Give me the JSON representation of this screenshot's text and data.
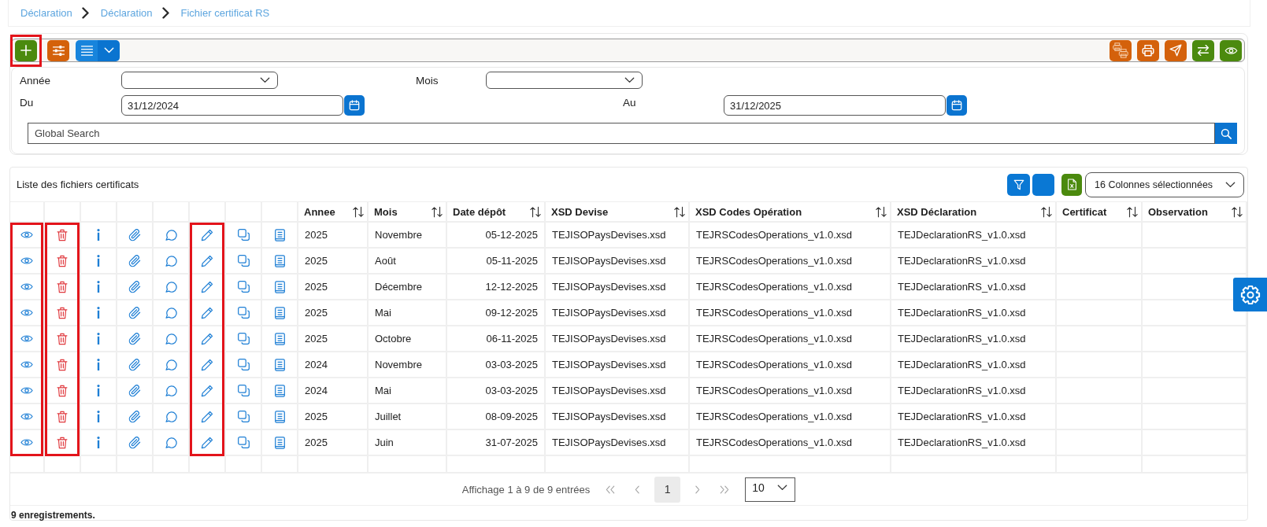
{
  "breadcrumb": [
    {
      "label": "Déclaration"
    },
    {
      "label": "Déclaration"
    },
    {
      "label": "Fichier certificat RS"
    }
  ],
  "toolbar": {
    "add_button": {
      "highlighted": true
    }
  },
  "filters": {
    "annee": {
      "label": "Année"
    },
    "mois": {
      "label": "Mois"
    },
    "du": {
      "label": "Du",
      "value": "31/12/2024"
    },
    "au": {
      "label": "Au",
      "value": "31/12/2025"
    },
    "global_search": {
      "placeholder": "Global Search"
    }
  },
  "table": {
    "title": "Liste des fichiers certificats",
    "column_selector": "16 Colonnes sélectionnées",
    "action_columns": [
      {
        "highlighted": true
      },
      {
        "highlighted": true
      },
      {
        "highlighted": false
      },
      {
        "highlighted": false
      },
      {
        "highlighted": false
      },
      {
        "highlighted": true
      },
      {
        "highlighted": false
      },
      {
        "highlighted": false
      }
    ],
    "columns": [
      {
        "label": "Annee"
      },
      {
        "label": "Mois"
      },
      {
        "label": "Date dépôt"
      },
      {
        "label": "XSD Devise"
      },
      {
        "label": "XSD Codes Opération"
      },
      {
        "label": "XSD Déclaration"
      },
      {
        "label": "Certificat"
      },
      {
        "label": "Observation"
      }
    ],
    "rows": [
      {
        "cells": [
          "2025",
          "Novembre",
          "05-12-2025",
          "TEJISOPaysDevises.xsd",
          "TEJRSCodesOperations_v1.0.xsd",
          "TEJDeclarationRS_v1.0.xsd"
        ]
      },
      {
        "cells": [
          "2025",
          "Août",
          "05-11-2025",
          "TEJISOPaysDevises.xsd",
          "TEJRSCodesOperations_v1.0.xsd",
          "TEJDeclarationRS_v1.0.xsd"
        ]
      },
      {
        "cells": [
          "2025",
          "Décembre",
          "12-12-2025",
          "TEJISOPaysDevises.xsd",
          "TEJRSCodesOperations_v1.0.xsd",
          "TEJDeclarationRS_v1.0.xsd"
        ]
      },
      {
        "cells": [
          "2025",
          "Mai",
          "09-12-2025",
          "TEJISOPaysDevises.xsd",
          "TEJRSCodesOperations_v1.0.xsd",
          "TEJDeclarationRS_v1.0.xsd"
        ]
      },
      {
        "cells": [
          "2025",
          "Octobre",
          "06-11-2025",
          "TEJISOPaysDevises.xsd",
          "TEJRSCodesOperations_v1.0.xsd",
          "TEJDeclarationRS_v1.0.xsd"
        ]
      },
      {
        "cells": [
          "2024",
          "Novembre",
          "03-03-2025",
          "TEJISOPaysDevises.xsd",
          "TEJRSCodesOperations_v1.0.xsd",
          "TEJDeclarationRS_v1.0.xsd"
        ]
      },
      {
        "cells": [
          "2024",
          "Mai",
          "03-03-2025",
          "TEJISOPaysDevises.xsd",
          "TEJRSCodesOperations_v1.0.xsd",
          "TEJDeclarationRS_v1.0.xsd"
        ]
      },
      {
        "cells": [
          "2025",
          "Juillet",
          "08-09-2025",
          "TEJISOPaysDevises.xsd",
          "TEJRSCodesOperations_v1.0.xsd",
          "TEJDeclarationRS_v1.0.xsd"
        ]
      },
      {
        "cells": [
          "2025",
          "Juin",
          "31-07-2025",
          "TEJISOPaysDevises.xsd",
          "TEJRSCodesOperations_v1.0.xsd",
          "TEJDeclarationRS_v1.0.xsd"
        ]
      }
    ]
  },
  "pagination": {
    "summary": "Affichage 1 à 9 de 9 entrées",
    "arrows_disabled": true,
    "pages": [
      {
        "label": "1",
        "selected": true
      }
    ],
    "page_size": "10"
  },
  "footer": {
    "record_count": "9 enregistrements."
  }
}
